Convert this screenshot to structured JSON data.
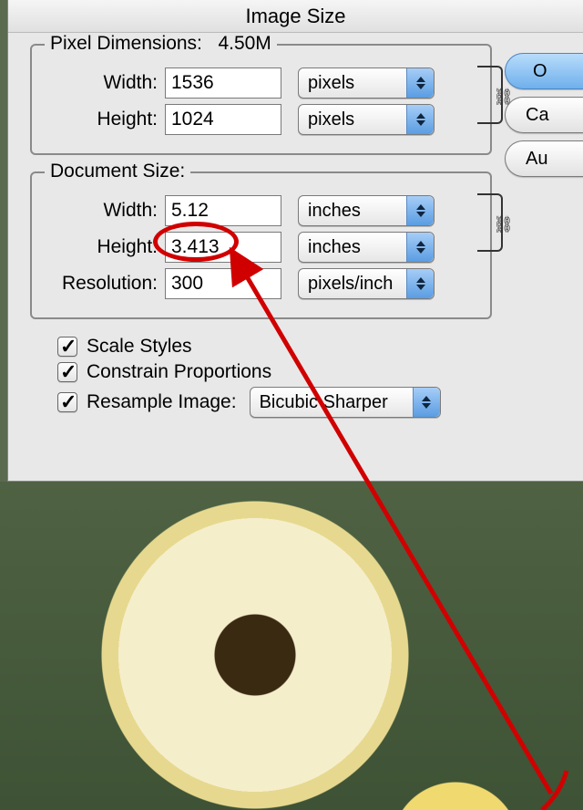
{
  "title": "Image Size",
  "pixel_dimensions": {
    "legend_prefix": "Pixel Dimensions:",
    "size": "4.50M",
    "width_label": "Width:",
    "width_value": "1536",
    "width_unit": "pixels",
    "height_label": "Height:",
    "height_value": "1024",
    "height_unit": "pixels"
  },
  "document_size": {
    "legend": "Document Size:",
    "width_label": "Width:",
    "width_value": "5.12",
    "width_unit": "inches",
    "height_label": "Height:",
    "height_value": "3.413",
    "height_unit": "inches",
    "resolution_label": "Resolution:",
    "resolution_value": "300",
    "resolution_unit": "pixels/inch"
  },
  "checks": {
    "scale_styles": "Scale Styles",
    "constrain": "Constrain Proportions",
    "resample": "Resample Image:",
    "method": "Bicubic Sharper"
  },
  "buttons": {
    "ok": "O",
    "cancel": "Ca",
    "auto": "Au"
  },
  "annotation": {
    "color": "#d10000"
  }
}
